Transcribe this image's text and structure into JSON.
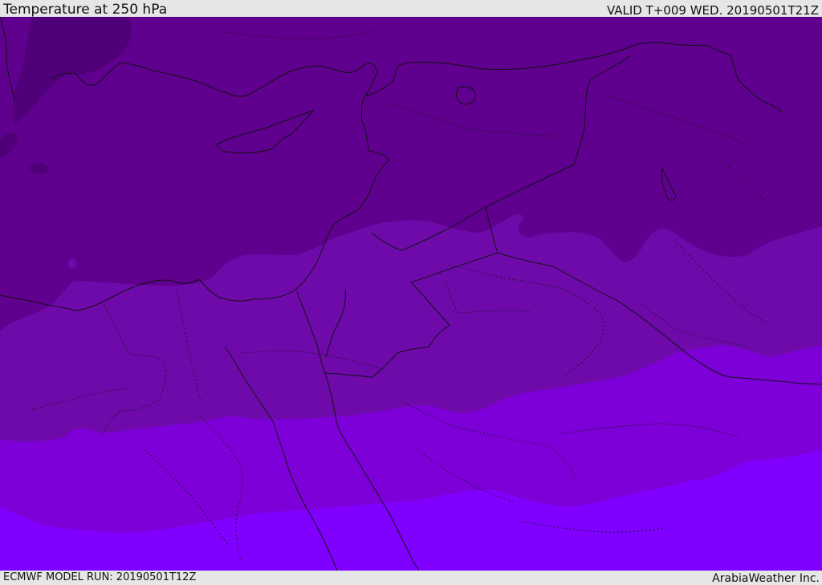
{
  "header": {
    "title": "Temperature at 250 hPa",
    "valid_time": "VALID T+009 WED. 20190501T21Z"
  },
  "footer": {
    "model_run": "ECMWF MODEL RUN: 20190501T12Z",
    "credit": "ArabiaWeather Inc."
  },
  "map": {
    "field": "temperature",
    "pressure_level_hpa": 250,
    "band_colors": [
      "#4f0078",
      "#60008e",
      "#6f0aaa",
      "#7e00d8",
      "#7f00ff"
    ],
    "coastline_color": "#111111",
    "border_style": "dotted"
  }
}
